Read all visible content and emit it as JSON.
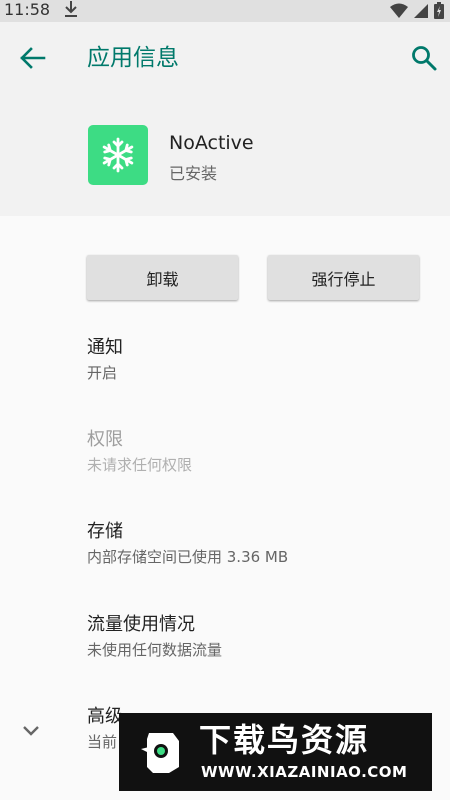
{
  "status_bar": {
    "time": "11:58"
  },
  "app_bar": {
    "title": "应用信息"
  },
  "app": {
    "name": "NoActive",
    "install_status": "已安装"
  },
  "buttons": {
    "uninstall": "卸载",
    "force_stop": "强行停止"
  },
  "prefs": [
    {
      "title": "通知",
      "summary": "开启",
      "enabled": true
    },
    {
      "title": "权限",
      "summary": "未请求任何权限",
      "enabled": false
    },
    {
      "title": "存储",
      "summary": "内部存储空间已使用 3.36 MB",
      "enabled": true
    },
    {
      "title": "流量使用情况",
      "summary": "未使用任何数据流量",
      "enabled": true
    },
    {
      "title": "高级",
      "summary": "当前",
      "enabled": true
    }
  ],
  "watermark": {
    "title": "下载鸟资源",
    "url": "WWW.XIAZAINIAO.COM"
  },
  "colors": {
    "accent": "#00796b",
    "app_icon_bg": "#3ddc84",
    "header_bg": "#f2f2f2",
    "status_bar_bg": "#e0e0e0"
  },
  "icons": [
    "download-icon",
    "wifi-icon",
    "signal-icon",
    "battery-icon",
    "back-arrow-icon",
    "search-icon",
    "snowflake-icon",
    "chevron-down-icon"
  ]
}
